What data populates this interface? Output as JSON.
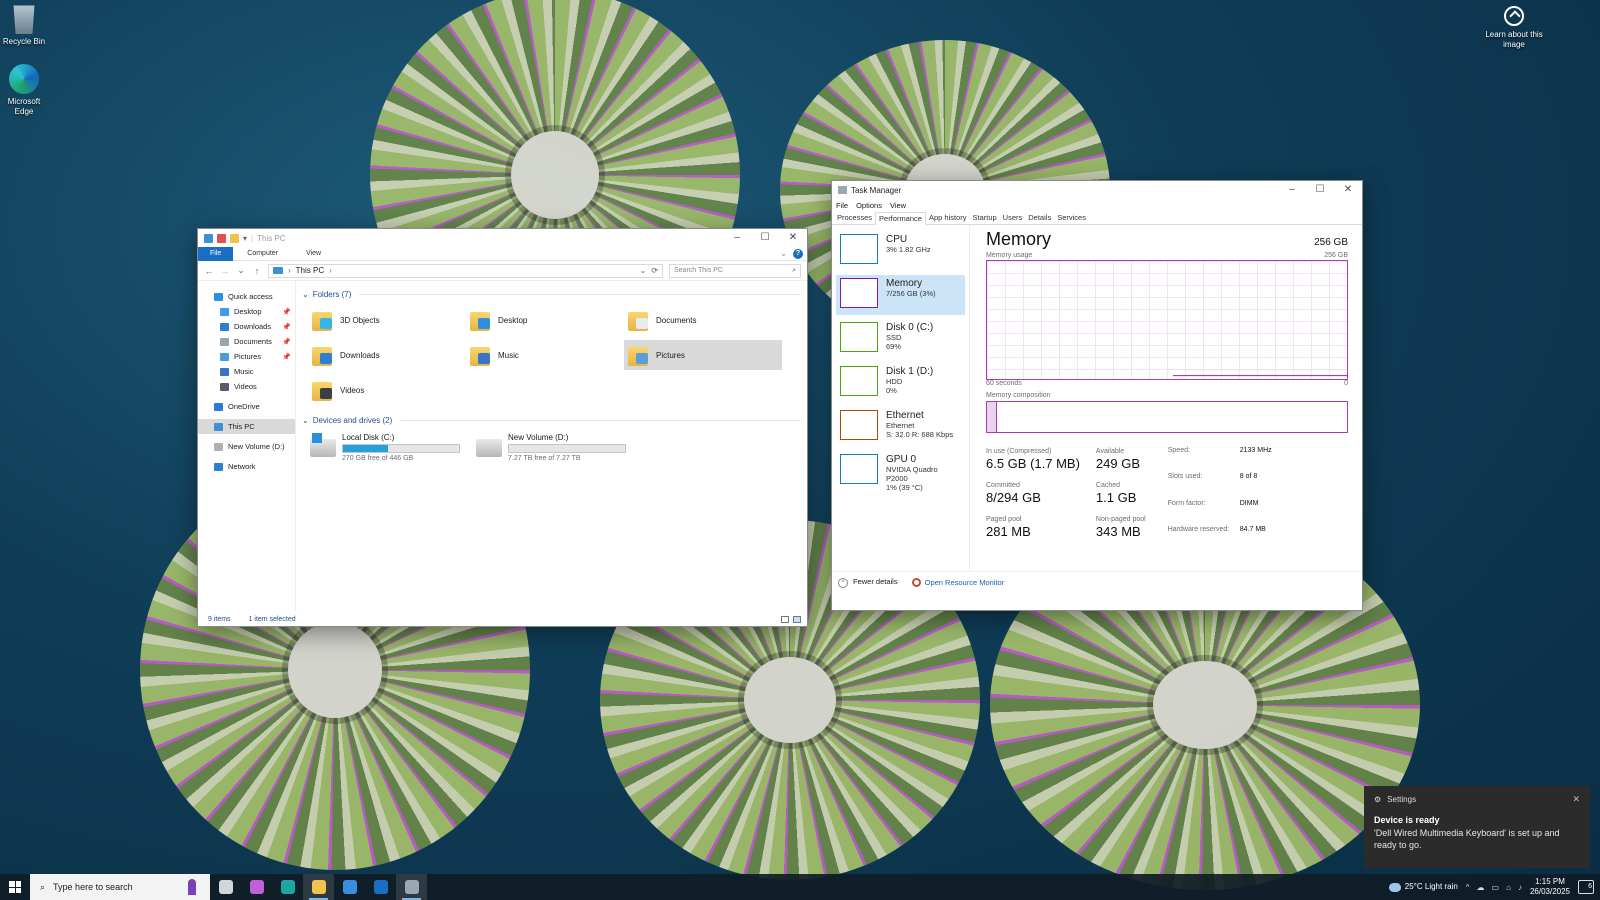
{
  "desktop": {
    "icons": [
      {
        "label": "Recycle Bin"
      },
      {
        "label": "Microsoft Edge"
      }
    ],
    "learn_label": "Learn about this image"
  },
  "explorer": {
    "title": "This PC",
    "ribbon_tabs": [
      "File",
      "Computer",
      "View"
    ],
    "address": "This PC",
    "search_placeholder": "Search This PC",
    "nav": [
      {
        "label": "Quick access",
        "color": "#2f8ee0"
      },
      {
        "label": "Desktop",
        "color": "#3d9be9",
        "pinned": true
      },
      {
        "label": "Downloads",
        "color": "#2f7fd0",
        "pinned": true
      },
      {
        "label": "Documents",
        "color": "#9aa5b1",
        "pinned": true
      },
      {
        "label": "Pictures",
        "color": "#4d9bd8",
        "pinned": true
      },
      {
        "label": "Music",
        "color": "#3a74c9"
      },
      {
        "label": "Videos",
        "color": "#555e6a"
      },
      {
        "label": "OneDrive",
        "color": "#2a7ad8"
      },
      {
        "label": "This PC",
        "color": "#3d8fd6"
      },
      {
        "label": "New Volume (D:)",
        "color": "#b0b0b0"
      },
      {
        "label": "Network",
        "color": "#2f7fd0"
      }
    ],
    "folders_header": "Folders (7)",
    "folders": [
      {
        "label": "3D Objects",
        "badge": "#36b6e6"
      },
      {
        "label": "Desktop",
        "badge": "#2f8ee0"
      },
      {
        "label": "Documents",
        "badge": "#e7ecf1"
      },
      {
        "label": "Downloads",
        "badge": "#2f7fd0"
      },
      {
        "label": "Music",
        "badge": "#3a74c9"
      },
      {
        "label": "Pictures",
        "badge": "#5aa0d6"
      },
      {
        "label": "Videos",
        "badge": "#3b3f46"
      }
    ],
    "drives_header": "Devices and drives (2)",
    "drives": [
      {
        "label": "Local Disk (C:)",
        "free": "270 GB free of 446 GB",
        "used_fraction": 0.39
      },
      {
        "label": "New Volume (D:)",
        "free": "7.27 TB free of 7.27 TB",
        "used_fraction": 0.0
      }
    ],
    "status_items": "9 items",
    "status_selected": "1 item selected"
  },
  "taskmgr": {
    "title": "Task Manager",
    "menu": [
      "File",
      "Options",
      "View"
    ],
    "tabs": [
      "Processes",
      "Performance",
      "App history",
      "Startup",
      "Users",
      "Details",
      "Services"
    ],
    "resources": [
      {
        "name": "CPU",
        "sub1": "3%  1.82 GHz",
        "sub2": "",
        "sub3": "",
        "color": "#117dbb"
      },
      {
        "name": "Memory",
        "sub1": "7/256 GB (3%)",
        "sub2": "",
        "sub3": "",
        "color": "#8b12ae"
      },
      {
        "name": "Disk 0 (C:)",
        "sub1": "SSD",
        "sub2": "69%",
        "sub3": "",
        "color": "#4da60c"
      },
      {
        "name": "Disk 1 (D:)",
        "sub1": "HDD",
        "sub2": "0%",
        "sub3": "",
        "color": "#4da60c"
      },
      {
        "name": "Ethernet",
        "sub1": "Ethernet",
        "sub2": "S: 32.0  R: 688 Kbps",
        "sub3": "",
        "color": "#a74f01"
      },
      {
        "name": "GPU 0",
        "sub1": "NVIDIA Quadro P2000",
        "sub2": "1%  (39 °C)",
        "sub3": "",
        "color": "#117dbb"
      }
    ],
    "memory": {
      "title": "Memory",
      "capacity": "256 GB",
      "usage_label": "Memory usage",
      "usage_max": "256 GB",
      "time_label": "60 seconds",
      "time_min": "0",
      "composition_label": "Memory composition",
      "in_use_label": "In use (Compressed)",
      "in_use": "6.5 GB (1.7 MB)",
      "available_label": "Available",
      "available": "249 GB",
      "committed_label": "Committed",
      "committed": "8/294 GB",
      "cached_label": "Cached",
      "cached": "1.1 GB",
      "paged_label": "Paged pool",
      "paged": "281 MB",
      "nonpaged_label": "Non-paged pool",
      "nonpaged": "343 MB",
      "specs": [
        {
          "k": "Speed:",
          "v": "2133 MHz"
        },
        {
          "k": "Slots used:",
          "v": "8 of 8"
        },
        {
          "k": "Form factor:",
          "v": "DIMM"
        },
        {
          "k": "Hardware reserved:",
          "v": "84.7 MB"
        }
      ]
    },
    "fewer_details": "Fewer details",
    "open_rm": "Open Resource Monitor"
  },
  "toast": {
    "app": "Settings",
    "title": "Device is ready",
    "message": "'Dell Wired Multimedia Keyboard' is set up and ready to go."
  },
  "taskbar": {
    "search_placeholder": "Type here to search",
    "apps": [
      {
        "name": "task-view-icon",
        "color": "#cfd6dd"
      },
      {
        "name": "copilot-icon",
        "color": "#c060d8"
      },
      {
        "name": "edge-icon",
        "color": "#1fa3a3"
      },
      {
        "name": "file-explorer-icon",
        "color": "#f1c24c"
      },
      {
        "name": "store-icon",
        "color": "#3a8ee0"
      },
      {
        "name": "outlook-icon",
        "color": "#1a6fc4"
      },
      {
        "name": "task-manager-icon",
        "color": "#9aa8b4"
      }
    ],
    "weather": "25°C  Light rain",
    "time": "1:15 PM",
    "date": "26/03/2025",
    "notif_count": "6"
  }
}
